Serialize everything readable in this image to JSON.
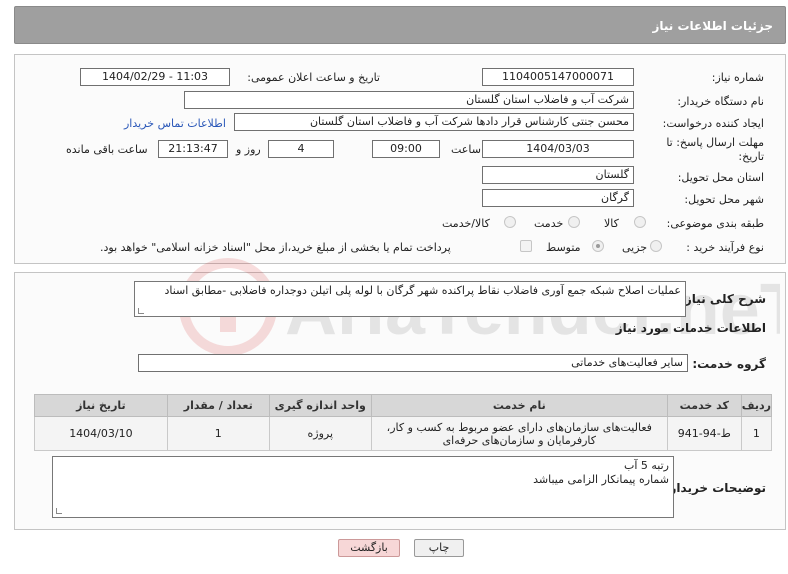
{
  "header": {
    "title": "جزئیات اطلاعات نیاز"
  },
  "fields": {
    "need_number_label": "شماره نیاز:",
    "need_number": "1104005147000071",
    "announce_label": "تاریخ و ساعت اعلان عمومی:",
    "announce_value": "1404/02/29 - 11:03",
    "buyer_label": "نام دستگاه خریدار:",
    "buyer_value": "شرکت آب و فاضلاب استان گلستان",
    "creator_label": "ایجاد کننده درخواست:",
    "creator_value": "محسن جنتی کارشناس قرار دادها شرکت آب و فاضلاب استان گلستان",
    "contact_link": "اطلاعات تماس خریدار",
    "deadline_label": "مهلت ارسال پاسخ: تا تاریخ:",
    "deadline_date": "1404/03/03",
    "time_label": "ساعت",
    "deadline_time": "09:00",
    "days_value": "4",
    "days_label": "روز و",
    "remaining_time": "21:13:47",
    "remaining_label": "ساعت باقی مانده",
    "province_label": "استان محل تحویل:",
    "province_value": "گلستان",
    "city_label": "شهر محل تحویل:",
    "city_value": "گرگان",
    "category_label": "طبقه بندی موضوعی:",
    "category_options": [
      "کالا",
      "خدمت",
      "کالا/خدمت"
    ],
    "process_label": "نوع فرآیند خرید :",
    "process_options": [
      "جزیی",
      "متوسط"
    ],
    "payment_note": "پرداخت تمام یا بخشی از مبلغ خرید،از محل \"اسناد خزانه اسلامی\" خواهد بود."
  },
  "summary": {
    "label": "شرح کلی نیاز:",
    "text": "عملیات اصلاح شبکه جمع آوری فاضلاب نقاط پراکنده شهر گرگان با لوله پلی اتیلن دوجداره فاضلابی -مطابق اسناد",
    "services_title": "اطلاعات خدمات مورد نیاز",
    "group_label": "گروه خدمت:",
    "group_value": "سایر فعالیت‌های خدماتی"
  },
  "table": {
    "headers": [
      "ردیف",
      "کد خدمت",
      "نام خدمت",
      "واحد اندازه گیری",
      "تعداد / مقدار",
      "تاریخ نیاز"
    ],
    "rows": [
      {
        "row": "1",
        "code": "ط-94-941",
        "name_line1": "فعالیت‌های سازمان‌های دارای عضو مربوط به کسب و کار،",
        "name_line2": "کارفرمایان و سازمان‌های حرفه‌ای",
        "unit": "پروژه",
        "qty": "1",
        "date": "1404/03/10"
      }
    ]
  },
  "buyer_notes": {
    "label": "توضیحات خریدار:",
    "line1": "رتبه 5 آب",
    "line2": "شماره پیمانکار الزامی میباشد"
  },
  "buttons": {
    "print": "چاپ",
    "back": "بازگشت"
  },
  "watermark": {
    "text": "AriaTender.neT"
  }
}
